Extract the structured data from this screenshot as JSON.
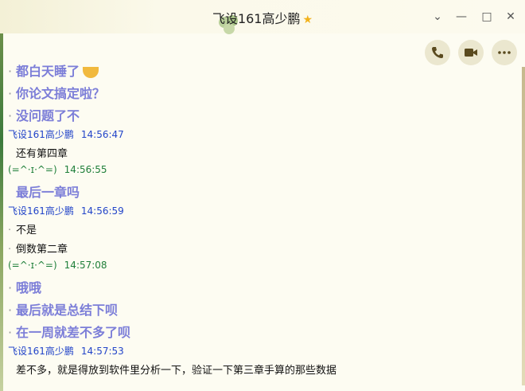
{
  "window": {
    "title": "飞设161高少鹏",
    "title_star": "★",
    "minimize": "—",
    "maximize": "□",
    "close": "✕",
    "dropdown": "⌄"
  },
  "toolbar": {
    "call_icon": "phone-icon",
    "video_icon": "video-icon",
    "more_icon": "more-icon"
  },
  "colors": {
    "name_blue": "#2345c9",
    "name_green": "#1f7f3a",
    "big_text": "#7c7ed8"
  },
  "messages": [
    {
      "type": "big",
      "text": "都白天睡了"
    },
    {
      "type": "big",
      "text": "你论文搞定啦？"
    },
    {
      "type": "big",
      "text": "没问题了不"
    },
    {
      "type": "header",
      "name": "飞设161高少鹏",
      "time": "14:56:47",
      "color": "blue"
    },
    {
      "type": "small",
      "text": "还有第四章"
    },
    {
      "type": "header",
      "name": "(=^·ɪ·^=)",
      "time": "14:56:55",
      "color": "green"
    },
    {
      "type": "big",
      "text": "最后一章吗"
    },
    {
      "type": "header",
      "name": "飞设161高少鹏",
      "time": "14:56:59",
      "color": "blue"
    },
    {
      "type": "small",
      "text": "不是"
    },
    {
      "type": "small",
      "text": "倒数第二章"
    },
    {
      "type": "header",
      "name": "(=^·ɪ·^=)",
      "time": "14:57:08",
      "color": "green"
    },
    {
      "type": "big",
      "text": "哦哦"
    },
    {
      "type": "big",
      "text": "最后就是总结下呗"
    },
    {
      "type": "big",
      "text": "在一周就差不多了呗"
    },
    {
      "type": "header",
      "name": "飞设161高少鹏",
      "time": "14:57:53",
      "color": "blue"
    },
    {
      "type": "small",
      "text": "差不多，就是得放到软件里分析一下，验证一下第三章手算的那些数据"
    }
  ]
}
